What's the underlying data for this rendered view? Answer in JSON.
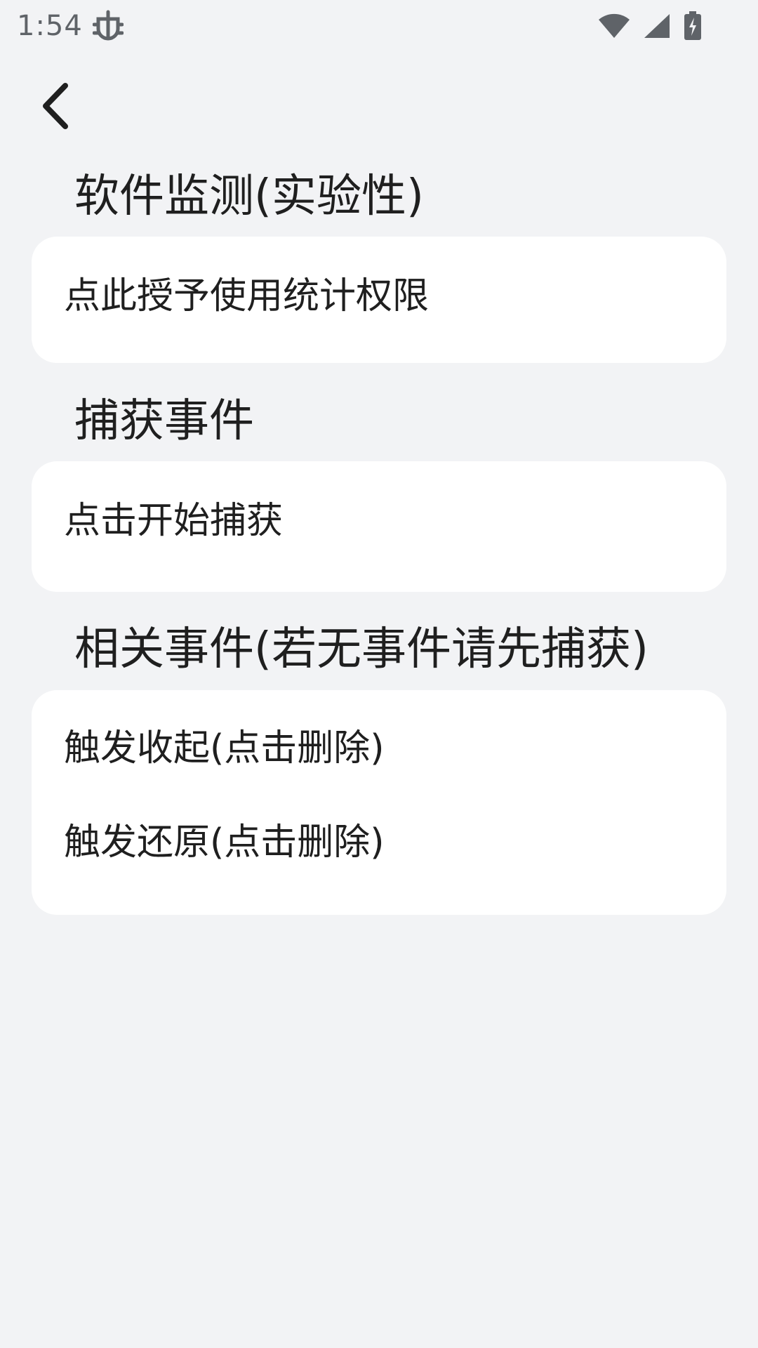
{
  "status_bar": {
    "time": "1:54",
    "icons": [
      "bug-icon",
      "wifi-icon",
      "signal-icon",
      "battery-charging-icon"
    ]
  },
  "nav": {
    "back_icon": "chevron-left-icon"
  },
  "sections": {
    "app_monitor": {
      "title": "软件监测(实验性)",
      "items": [
        "点此授予使用统计权限"
      ]
    },
    "capture": {
      "title": "捕获事件",
      "items": [
        "点击开始捕获"
      ]
    },
    "related": {
      "title": "相关事件(若无事件请先捕获)",
      "items": [
        "触发收起(点击删除)",
        "触发还原(点击删除)"
      ]
    }
  },
  "colors": {
    "background": "#f2f3f5",
    "card": "#ffffff",
    "text": "#1f1f1f",
    "status": "#5f6368"
  }
}
